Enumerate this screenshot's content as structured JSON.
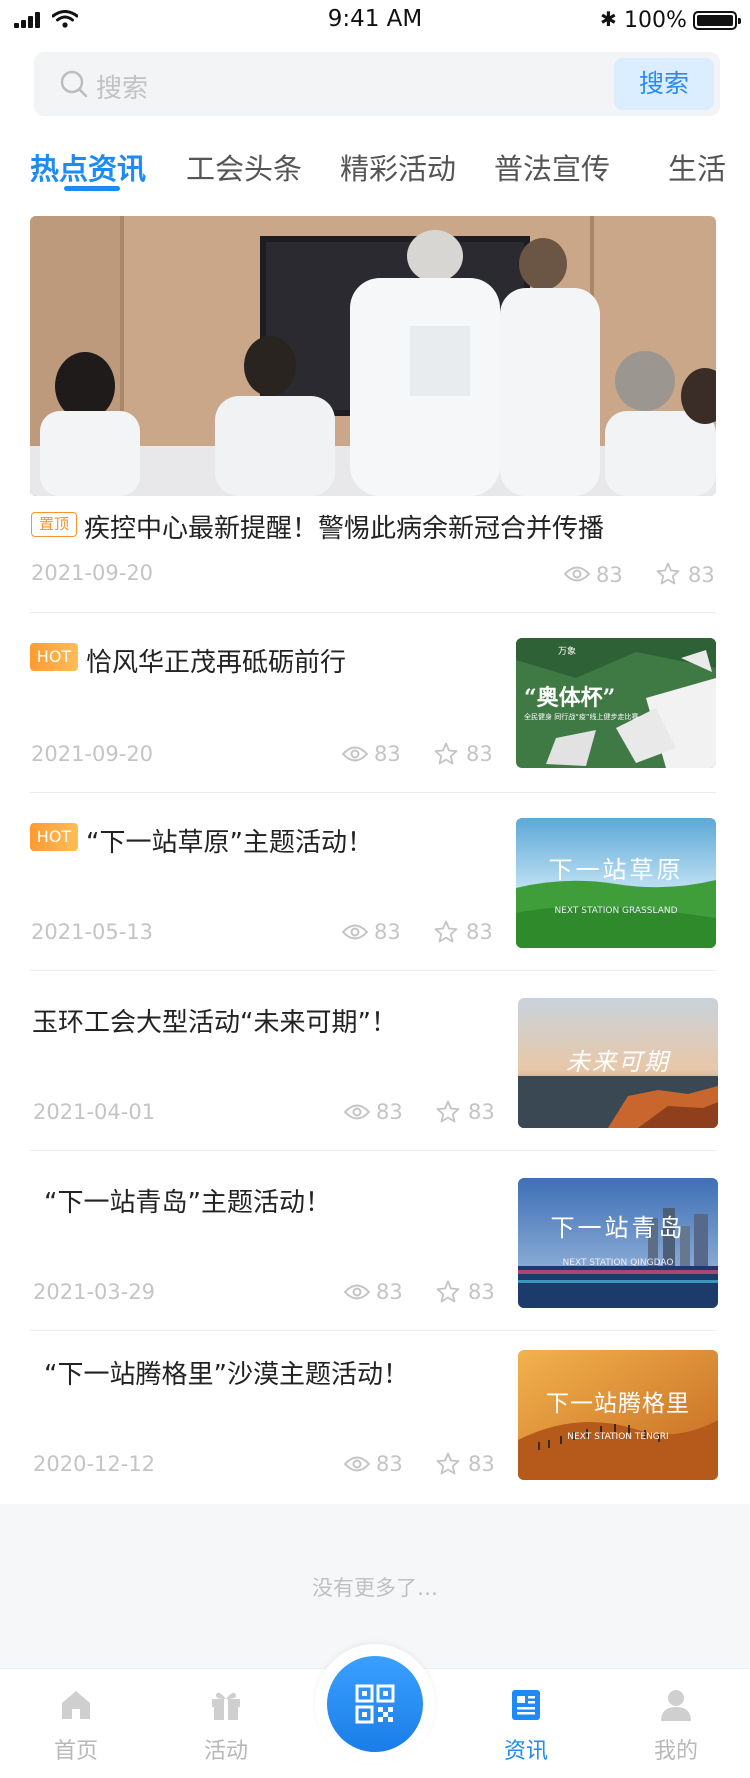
{
  "status_bar": {
    "time": "9:41 AM",
    "battery": "100%"
  },
  "search": {
    "placeholder": "搜索",
    "button_label": "搜索"
  },
  "tabs": [
    {
      "label": "热点资讯",
      "active": true
    },
    {
      "label": "工会头条"
    },
    {
      "label": "精彩活动"
    },
    {
      "label": "普法宣传"
    },
    {
      "label": "生活"
    }
  ],
  "featured": {
    "badge": "置顶",
    "title": "疾控中心最新提醒！警惕此病余新冠合并传播",
    "date": "2021-09-20",
    "views": "83",
    "stars": "83"
  },
  "news": [
    {
      "badge": "HOT",
      "title": "恰风华正茂再砥砺前行",
      "date": "2021-09-20",
      "views": "83",
      "stars": "83",
      "thumb_title": "“奥体杯”",
      "thumb_sub": "全民健身 同行战“疫”线上健步走比赛",
      "thumb_tag": "万象"
    },
    {
      "badge": "HOT",
      "title": "“下一站草原”主题活动！",
      "date": "2021-05-13",
      "views": "83",
      "stars": "83",
      "thumb_title": "下一站草原",
      "thumb_sub": "NEXT STATION GRASSLAND"
    },
    {
      "badge": "",
      "title": "玉环工会大型活动“未来可期”！",
      "date": "2021-04-01",
      "views": "83",
      "stars": "83",
      "thumb_title": "未来可期",
      "thumb_sub": ""
    },
    {
      "badge": "",
      "title": "“下一站青岛”主题活动！",
      "date": "2021-03-29",
      "views": "83",
      "stars": "83",
      "thumb_title": "下一站青岛",
      "thumb_sub": "NEXT STATION QINGDAO"
    },
    {
      "badge": "",
      "title": "“下一站腾格里”沙漠主题活动！",
      "date": "2020-12-12",
      "views": "83",
      "stars": "83",
      "thumb_title": "下一站腾格里",
      "thumb_sub": "NEXT STATION TENGRI"
    }
  ],
  "no_more": "没有更多了…",
  "nav": [
    {
      "label": "首页",
      "icon": "home-icon"
    },
    {
      "label": "活动",
      "icon": "gift-icon"
    },
    {
      "label": "资讯",
      "icon": "news-icon",
      "active": true
    },
    {
      "label": "我的",
      "icon": "user-icon"
    }
  ],
  "colors": {
    "accent": "#1e8af5",
    "hot": "#ff9a32",
    "muted": "#c4c4c4"
  }
}
